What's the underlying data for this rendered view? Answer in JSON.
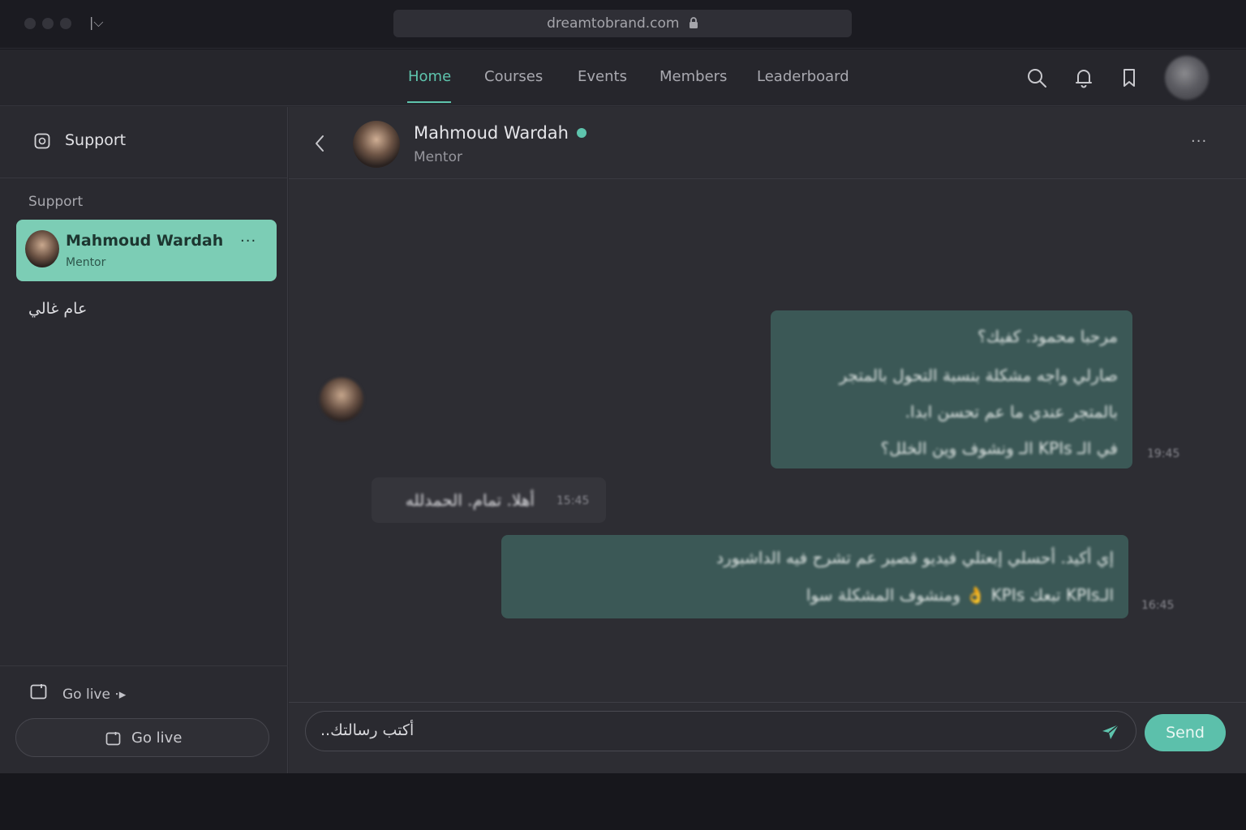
{
  "browser": {
    "url": "dreamtobrand.com",
    "tab_control": "|⌵"
  },
  "nav": {
    "items": [
      {
        "label": "Home",
        "active": true
      },
      {
        "label": "Courses",
        "active": false
      },
      {
        "label": "Events",
        "active": false
      },
      {
        "label": "Members",
        "active": false
      },
      {
        "label": "Leaderboard",
        "active": false
      }
    ],
    "icons": [
      "search-icon",
      "bell-icon",
      "bookmark-icon"
    ]
  },
  "sidebar": {
    "header_title": "Support",
    "section_title": "Support",
    "contact": {
      "name": "Mahmoud Wardah",
      "role": "Mentor",
      "more": "···"
    },
    "arabic_item": "عام غالي",
    "footer_label": "Go live ⋅▸",
    "go_live_button": "Go live"
  },
  "chat": {
    "name": "Mahmoud Wardah",
    "role": "Mentor",
    "online": true,
    "more": "···",
    "messages": [
      {
        "direction": "out",
        "lines": [
          "مرحبا محمود. كفيك؟",
          "صارلي واجه مشكلة بنسبة التحول بالمتجر",
          "بالمتجر عندي ما عم تحسن ابدا.",
          "في الـ KPIs الـ ونشوف وين الخلل؟"
        ],
        "time": "19:45"
      },
      {
        "direction": "in",
        "lines": [
          "أهلا. تمام. الحمدلله"
        ],
        "time": "15:45"
      },
      {
        "direction": "out",
        "lines": [
          "إي أكيد. أحسلي إبعتلي فيديو قصير عم تشرح فيه الداشبورد",
          "الـKPIs تبعك KPIs 👌 ومنشوف المشكلة سوا"
        ],
        "time": "16:45"
      }
    ]
  },
  "composer": {
    "placeholder": "أكتب رسالتك..",
    "send_label": "Send"
  },
  "colors": {
    "accent": "#5ec4ad",
    "card": "#7ccdb5",
    "outgoing_bubble": "#3b5856",
    "incoming_bubble": "#35353b",
    "background": "#2d2d33"
  }
}
